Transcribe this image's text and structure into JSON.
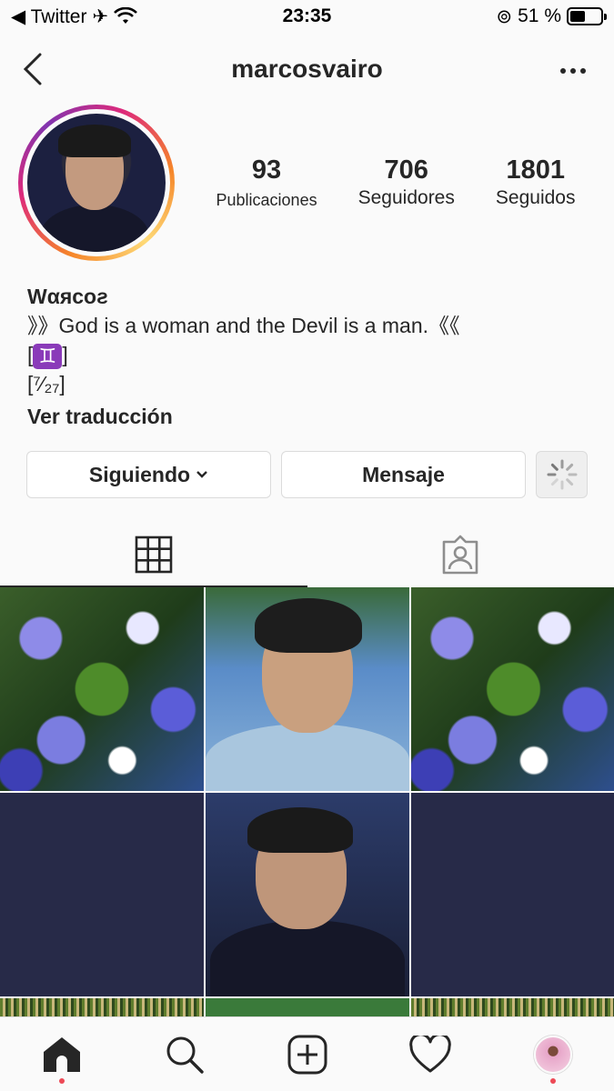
{
  "status_bar": {
    "back_app": "◀ Twitter",
    "time": "23:35",
    "battery_text": "51 %",
    "battery_level": 0.51
  },
  "header": {
    "username": "marcosvairo"
  },
  "stats": {
    "posts_count": "93",
    "posts_label": "Publicaciones",
    "followers_count": "706",
    "followers_label": "Seguidores",
    "following_count": "1801",
    "following_label": "Seguidos"
  },
  "bio": {
    "name": "Wαяcoƨ",
    "line1": "》》God is a woman and the Devil is a man.《《",
    "line2_prefix": "[",
    "gemini_symbol": "♊",
    "line2_suffix": "]",
    "line3": "[⁷⁄₂₇]",
    "translate_label": "Ver traducción"
  },
  "buttons": {
    "following_label": "Siguiendo",
    "message_label": "Mensaje"
  },
  "icons": {
    "back": "chevron-left-icon",
    "more": "more-icon",
    "grid": "grid-icon",
    "tagged": "tagged-icon",
    "home": "home-icon",
    "search": "search-icon",
    "add": "add-post-icon",
    "activity": "heart-icon",
    "suggest": "spinner-icon"
  },
  "colors": {
    "notification_dot": "#ed4956",
    "gemini_bg": "#8a3ab9"
  }
}
